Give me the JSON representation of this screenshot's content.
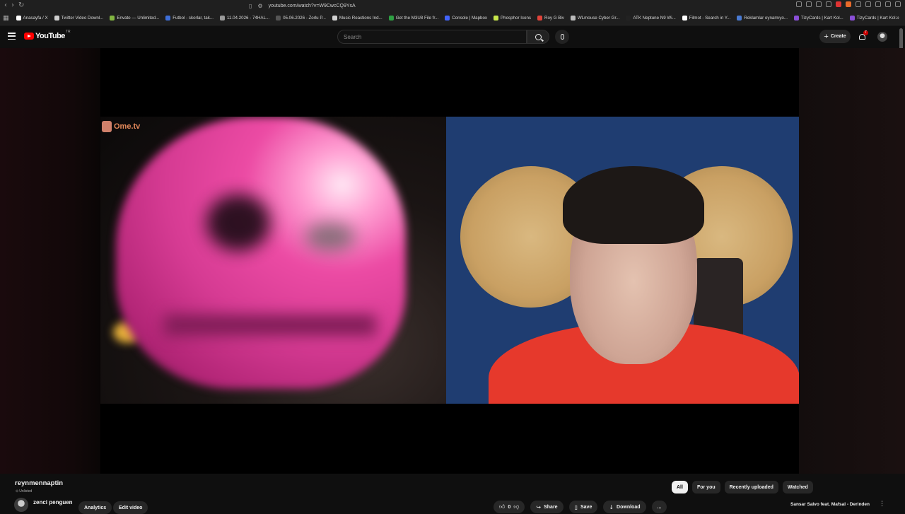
{
  "browser": {
    "url": "youtube.com/watch?v=W9CwcCQ9YsA",
    "bookmarks": [
      {
        "label": "Anasayfa / X",
        "color": "#ffffff"
      },
      {
        "label": "Twitter Video Downl...",
        "color": "#cfcfcf"
      },
      {
        "label": "Envato — Unlimited...",
        "color": "#82b541"
      },
      {
        "label": "Futbol - skorlar, tak...",
        "color": "#3e6fd8"
      },
      {
        "label": "11.04.2026 - 74HAL...",
        "color": "#9a9a9a"
      },
      {
        "label": "05.06.2026 - Zorlu P...",
        "color": "#555555"
      },
      {
        "label": "Music Reactions Ind...",
        "color": "#d0d0d0"
      },
      {
        "label": "Get the M3U8 File fr...",
        "color": "#2ea043"
      },
      {
        "label": "Console | Mapbox",
        "color": "#4264fb"
      },
      {
        "label": "Phosphor Icons",
        "color": "#c7e64b"
      },
      {
        "label": "Roy G Biv",
        "color": "#e0433a"
      },
      {
        "label": "WLmouse Cyber Gr...",
        "color": "#bbbbbb"
      },
      {
        "label": "ATK Neptune N9 Wi...",
        "color": "#222222"
      },
      {
        "label": "Filmot - Search in Y...",
        "color": "#ffffff"
      },
      {
        "label": "Reklamlar oynamıyo...",
        "color": "#4a7bd4"
      },
      {
        "label": "TizyCards | Kart Kol...",
        "color": "#8a4fd8"
      },
      {
        "label": "TizyCards | Kart Kol...",
        "color": "#8a4fd8"
      }
    ]
  },
  "header": {
    "logo_text": "YouTube",
    "country_code": "TR",
    "search_placeholder": "Search",
    "create_label": "Create",
    "notification_count": "7"
  },
  "player": {
    "overlay_brand": "Ome.tv"
  },
  "video": {
    "title": "reynmennaptin",
    "visibility": "Unlisted",
    "channel_name": "zenci penguen",
    "analytics_label": "Analytics",
    "edit_label": "Edit video",
    "like_count": "0",
    "share_label": "Share",
    "save_label": "Save",
    "download_label": "Download",
    "more_label": "..."
  },
  "sidebar": {
    "chips": [
      {
        "label": "All",
        "active": true
      },
      {
        "label": "For you",
        "active": false
      },
      {
        "label": "Recently uploaded",
        "active": false
      },
      {
        "label": "Watched",
        "active": false
      }
    ],
    "first_recommendation": "Sansar Salvo feat. Mafsal - Derinden"
  }
}
